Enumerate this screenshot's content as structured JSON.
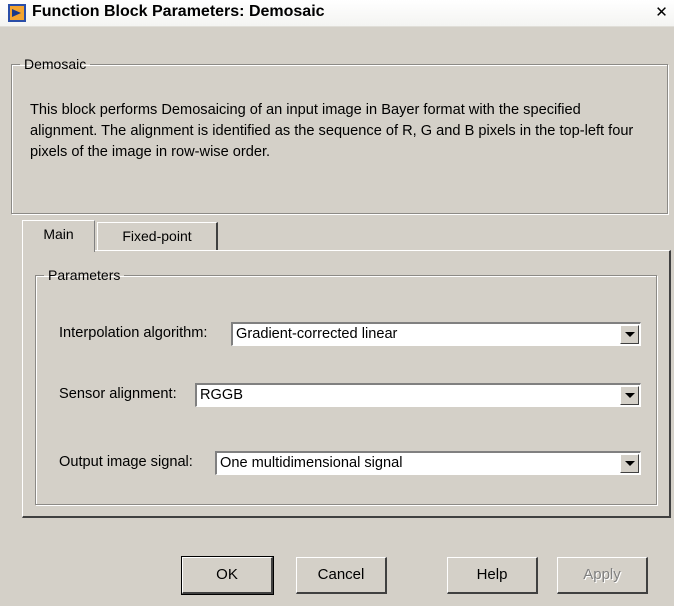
{
  "window": {
    "title": "Function Block Parameters: Demosaic",
    "close_glyph": "✕",
    "icon": "simulink-block-icon"
  },
  "description_group": {
    "legend": "Demosaic",
    "text": "This block performs Demosaicing of an input image in Bayer format with the specified alignment. The alignment is identified as the sequence of R, G and B pixels in the top-left four pixels of the image in row-wise order."
  },
  "tabs": [
    {
      "label": "Main",
      "active": true
    },
    {
      "label": "Fixed-point",
      "active": false
    }
  ],
  "parameters": {
    "legend": "Parameters",
    "interpolation": {
      "label": "Interpolation algorithm:",
      "value": "Gradient-corrected linear"
    },
    "sensor": {
      "label": "Sensor alignment:",
      "value": "RGGB"
    },
    "output": {
      "label": "Output image signal:",
      "value": "One multidimensional signal"
    }
  },
  "buttons": {
    "ok": "OK",
    "cancel": "Cancel",
    "help": "Help",
    "apply": "Apply"
  },
  "colors": {
    "dialog_bg": "#d4d0c8",
    "field_bg": "#ffffff",
    "disabled_text": "#808080"
  }
}
